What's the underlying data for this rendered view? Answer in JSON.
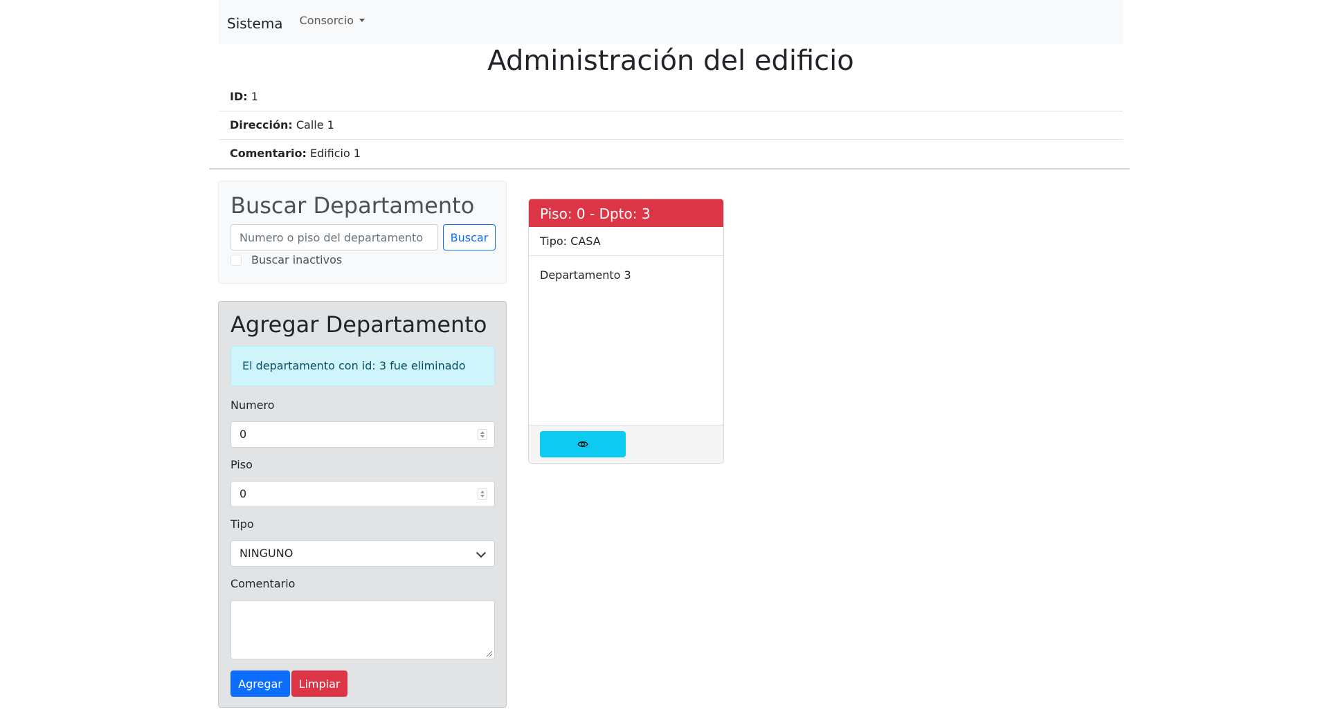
{
  "navbar": {
    "brand": "Sistema",
    "dropdown_label": "Consorcio"
  },
  "page_title": "Administración del edificio",
  "building": {
    "id_label": "ID:",
    "id_value": "1",
    "address_label": "Dirección:",
    "address_value": "Calle 1",
    "comment_label": "Comentario:",
    "comment_value": "Edificio 1"
  },
  "search": {
    "title": "Buscar Departamento",
    "placeholder": "Numero o piso del departamento",
    "button_label": "Buscar",
    "inactive_label": "Buscar inactivos",
    "inactive_checked": false
  },
  "add": {
    "title": "Agregar Departamento",
    "alert": "El departamento con id: 3 fue eliminado",
    "numero_label": "Numero",
    "numero_value": "0",
    "piso_label": "Piso",
    "piso_value": "0",
    "tipo_label": "Tipo",
    "tipo_value": "NINGUNO",
    "comentario_label": "Comentario",
    "comentario_value": "",
    "submit_label": "Agregar",
    "clear_label": "Limpiar"
  },
  "result_card": {
    "header": "Piso: 0 - Dpto: 3",
    "type": "Tipo: CASA",
    "body": "Departamento 3",
    "view_icon": "eye-icon",
    "header_color": "#dc3545"
  }
}
